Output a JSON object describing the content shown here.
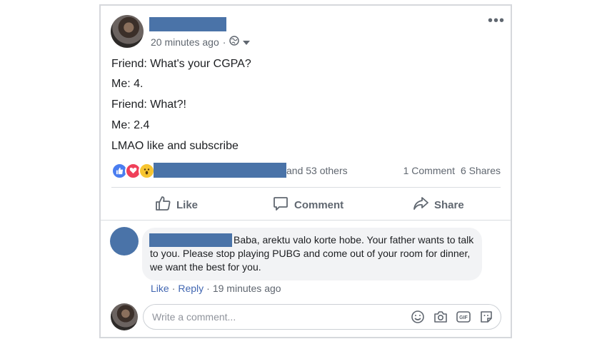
{
  "post": {
    "timestamp": "20 minutes ago",
    "separator": "·",
    "lines": [
      "Friend: What's your CGPA?",
      "Me: 4.",
      "Friend: What?!",
      "Me: 2.4",
      "LMAO like and subscribe"
    ],
    "likers_suffix": "and 53 others",
    "comment_count": "1 Comment",
    "share_count": "6 Shares"
  },
  "actions": {
    "like": "Like",
    "comment": "Comment",
    "share": "Share"
  },
  "comment": {
    "text": "Baba, arektu valo korte hobe. Your father wants to talk to you. Please stop playing PUBG and come out of your room for dinner, we want the best for you.",
    "like_label": "Like",
    "reply_label": "Reply",
    "dot": "·",
    "time": "19 minutes ago"
  },
  "composer": {
    "placeholder": "Write a comment..."
  },
  "colors": {
    "redaction": "#4a73a8",
    "link": "#4267b2",
    "muted": "#606770"
  },
  "icons": [
    "globe-icon",
    "chevron-down-icon",
    "more-icon",
    "like-reaction-icon",
    "love-reaction-icon",
    "wow-reaction-icon",
    "thumbs-up-icon",
    "speech-bubble-icon",
    "share-arrow-icon",
    "emoji-icon",
    "camera-icon",
    "gif-icon",
    "sticker-icon"
  ]
}
